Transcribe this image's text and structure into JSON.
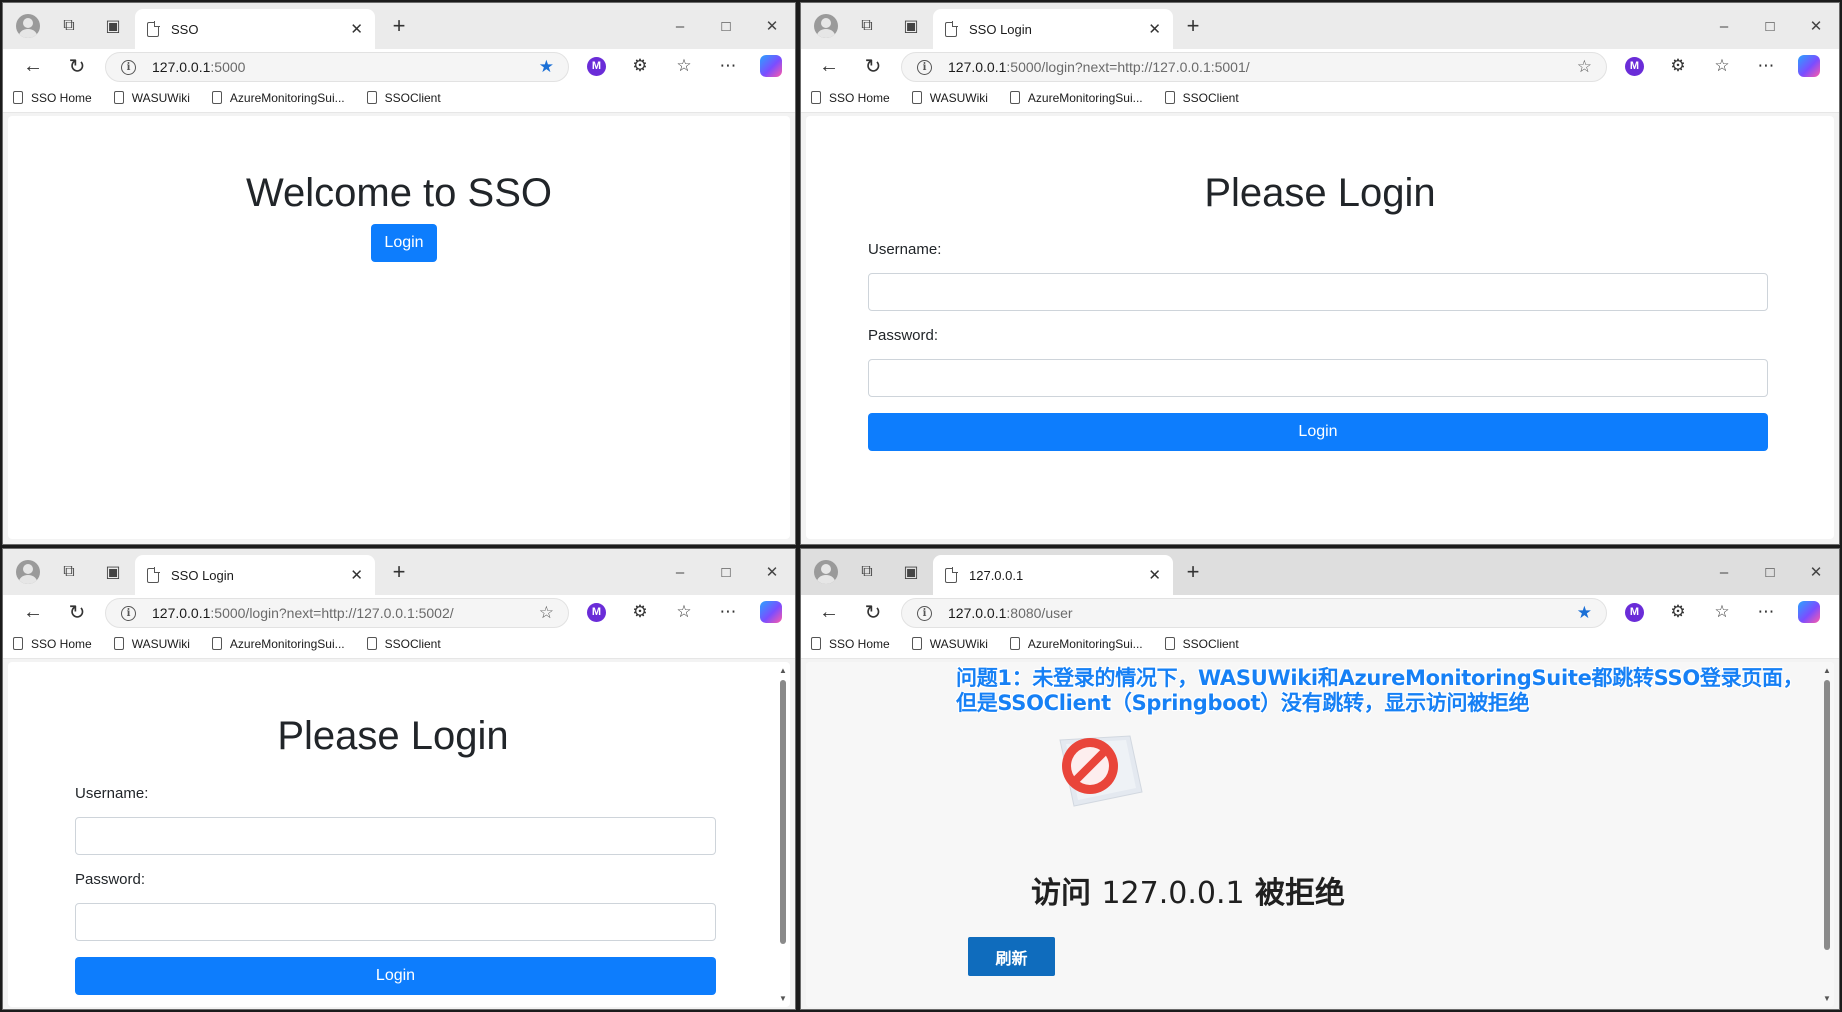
{
  "windows": [
    {
      "tab_title": "SSO",
      "url_host": "127.0.0.1",
      "url_path": ":5000",
      "bookmark_starred": true,
      "bookmarks": [
        "SSO Home",
        "WASUWiki",
        "AzureMonitoringSui...",
        "SSOClient"
      ],
      "page": {
        "heading": "Welcome to SSO",
        "login_button": "Login"
      }
    },
    {
      "tab_title": "SSO Login",
      "url_host": "127.0.0.1",
      "url_path": ":5000/login?next=http://127.0.0.1:5001/",
      "bookmark_starred": false,
      "bookmarks": [
        "SSO Home",
        "WASUWiki",
        "AzureMonitoringSui...",
        "SSOClient"
      ],
      "page": {
        "heading": "Please Login",
        "username_label": "Username:",
        "password_label": "Password:",
        "login_button": "Login"
      }
    },
    {
      "tab_title": "SSO Login",
      "url_host": "127.0.0.1",
      "url_path": ":5000/login?next=http://127.0.0.1:5002/",
      "bookmark_starred": false,
      "bookmarks": [
        "SSO Home",
        "WASUWiki",
        "AzureMonitoringSui...",
        "SSOClient"
      ],
      "page": {
        "heading": "Please Login",
        "username_label": "Username:",
        "password_label": "Password:",
        "login_button": "Login"
      }
    },
    {
      "tab_title": "127.0.0.1",
      "url_host": "127.0.0.1",
      "url_path": ":8080/user",
      "bookmark_starred": true,
      "bookmarks": [
        "SSO Home",
        "WASUWiki",
        "AzureMonitoringSui...",
        "SSOClient"
      ],
      "page": {
        "annotation_line1": "问题1：未登录的情况下，WASUWiki和AzureMonitoringSuite都跳转SSO登录页面，",
        "annotation_line2": "但是SSOClient（Springboot）没有跳转，显示访问被拒绝",
        "error_prefix": "访问",
        "error_ip": "127.0.0.1",
        "error_suffix": "被拒绝",
        "refresh_button": "刷新"
      }
    }
  ],
  "colors": {
    "primary_button": "#0d7dfd",
    "refresh_button": "#0f6cbd",
    "annotation_text": "#1680f5",
    "star_active": "#1a6fd6"
  },
  "icons": {
    "profile": "profile-icon",
    "workspaces": "workspaces-icon",
    "tab_actions": "vertical-tabs-icon",
    "back": "back-arrow-icon",
    "reload": "reload-icon",
    "favorites": "favorites-icon",
    "more": "more-icon",
    "extensions": "puzzle-icon",
    "denied": "prohibited-icon"
  }
}
